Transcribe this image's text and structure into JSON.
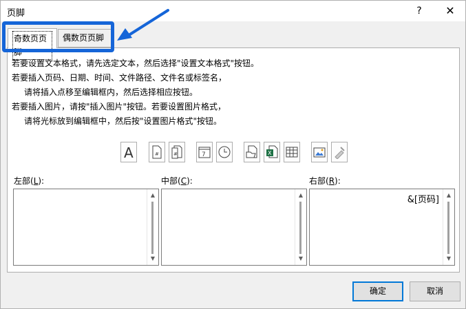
{
  "window": {
    "title": "页脚",
    "help_symbol": "?",
    "close_symbol": "✕"
  },
  "tabs": [
    {
      "label": "奇数页页脚",
      "active": true
    },
    {
      "label": "偶数页页脚",
      "active": false
    }
  ],
  "instructions": [
    {
      "text": "若要设置文本格式，请先选定文本，然后选择\"设置文本格式\"按钮。",
      "indent": false
    },
    {
      "text": "若要插入页码、日期、时间、文件路径、文件名或标签名，",
      "indent": false
    },
    {
      "text": "请将插入点移至编辑框内，然后选择相应按钮。",
      "indent": true
    },
    {
      "text": "若要插入图片，请按\"插入图片\"按钮。若要设置图片格式，",
      "indent": false
    },
    {
      "text": "请将光标放到编辑框中，然后按\"设置图片格式\"按钮。",
      "indent": true
    }
  ],
  "toolbar": [
    {
      "name": "format-text-icon"
    },
    {
      "name": "insert-page-number-icon"
    },
    {
      "name": "insert-page-count-icon"
    },
    {
      "name": "insert-date-icon"
    },
    {
      "name": "insert-time-icon"
    },
    {
      "name": "insert-file-path-icon"
    },
    {
      "name": "insert-file-name-icon"
    },
    {
      "name": "insert-sheet-name-icon"
    },
    {
      "name": "insert-picture-icon"
    },
    {
      "name": "format-picture-icon"
    }
  ],
  "sections": {
    "left": {
      "label_prefix": "左部(",
      "hotkey": "L",
      "label_suffix": "):",
      "value": ""
    },
    "center": {
      "label_prefix": "中部(",
      "hotkey": "C",
      "label_suffix": "):",
      "value": ""
    },
    "right": {
      "label_prefix": "右部(",
      "hotkey": "R",
      "label_suffix": "):",
      "value": "&[页码]"
    }
  },
  "buttons": {
    "ok": "确定",
    "cancel": "取消"
  },
  "colors": {
    "highlight": "#1565d8",
    "default_button_border": "#0078d7"
  }
}
